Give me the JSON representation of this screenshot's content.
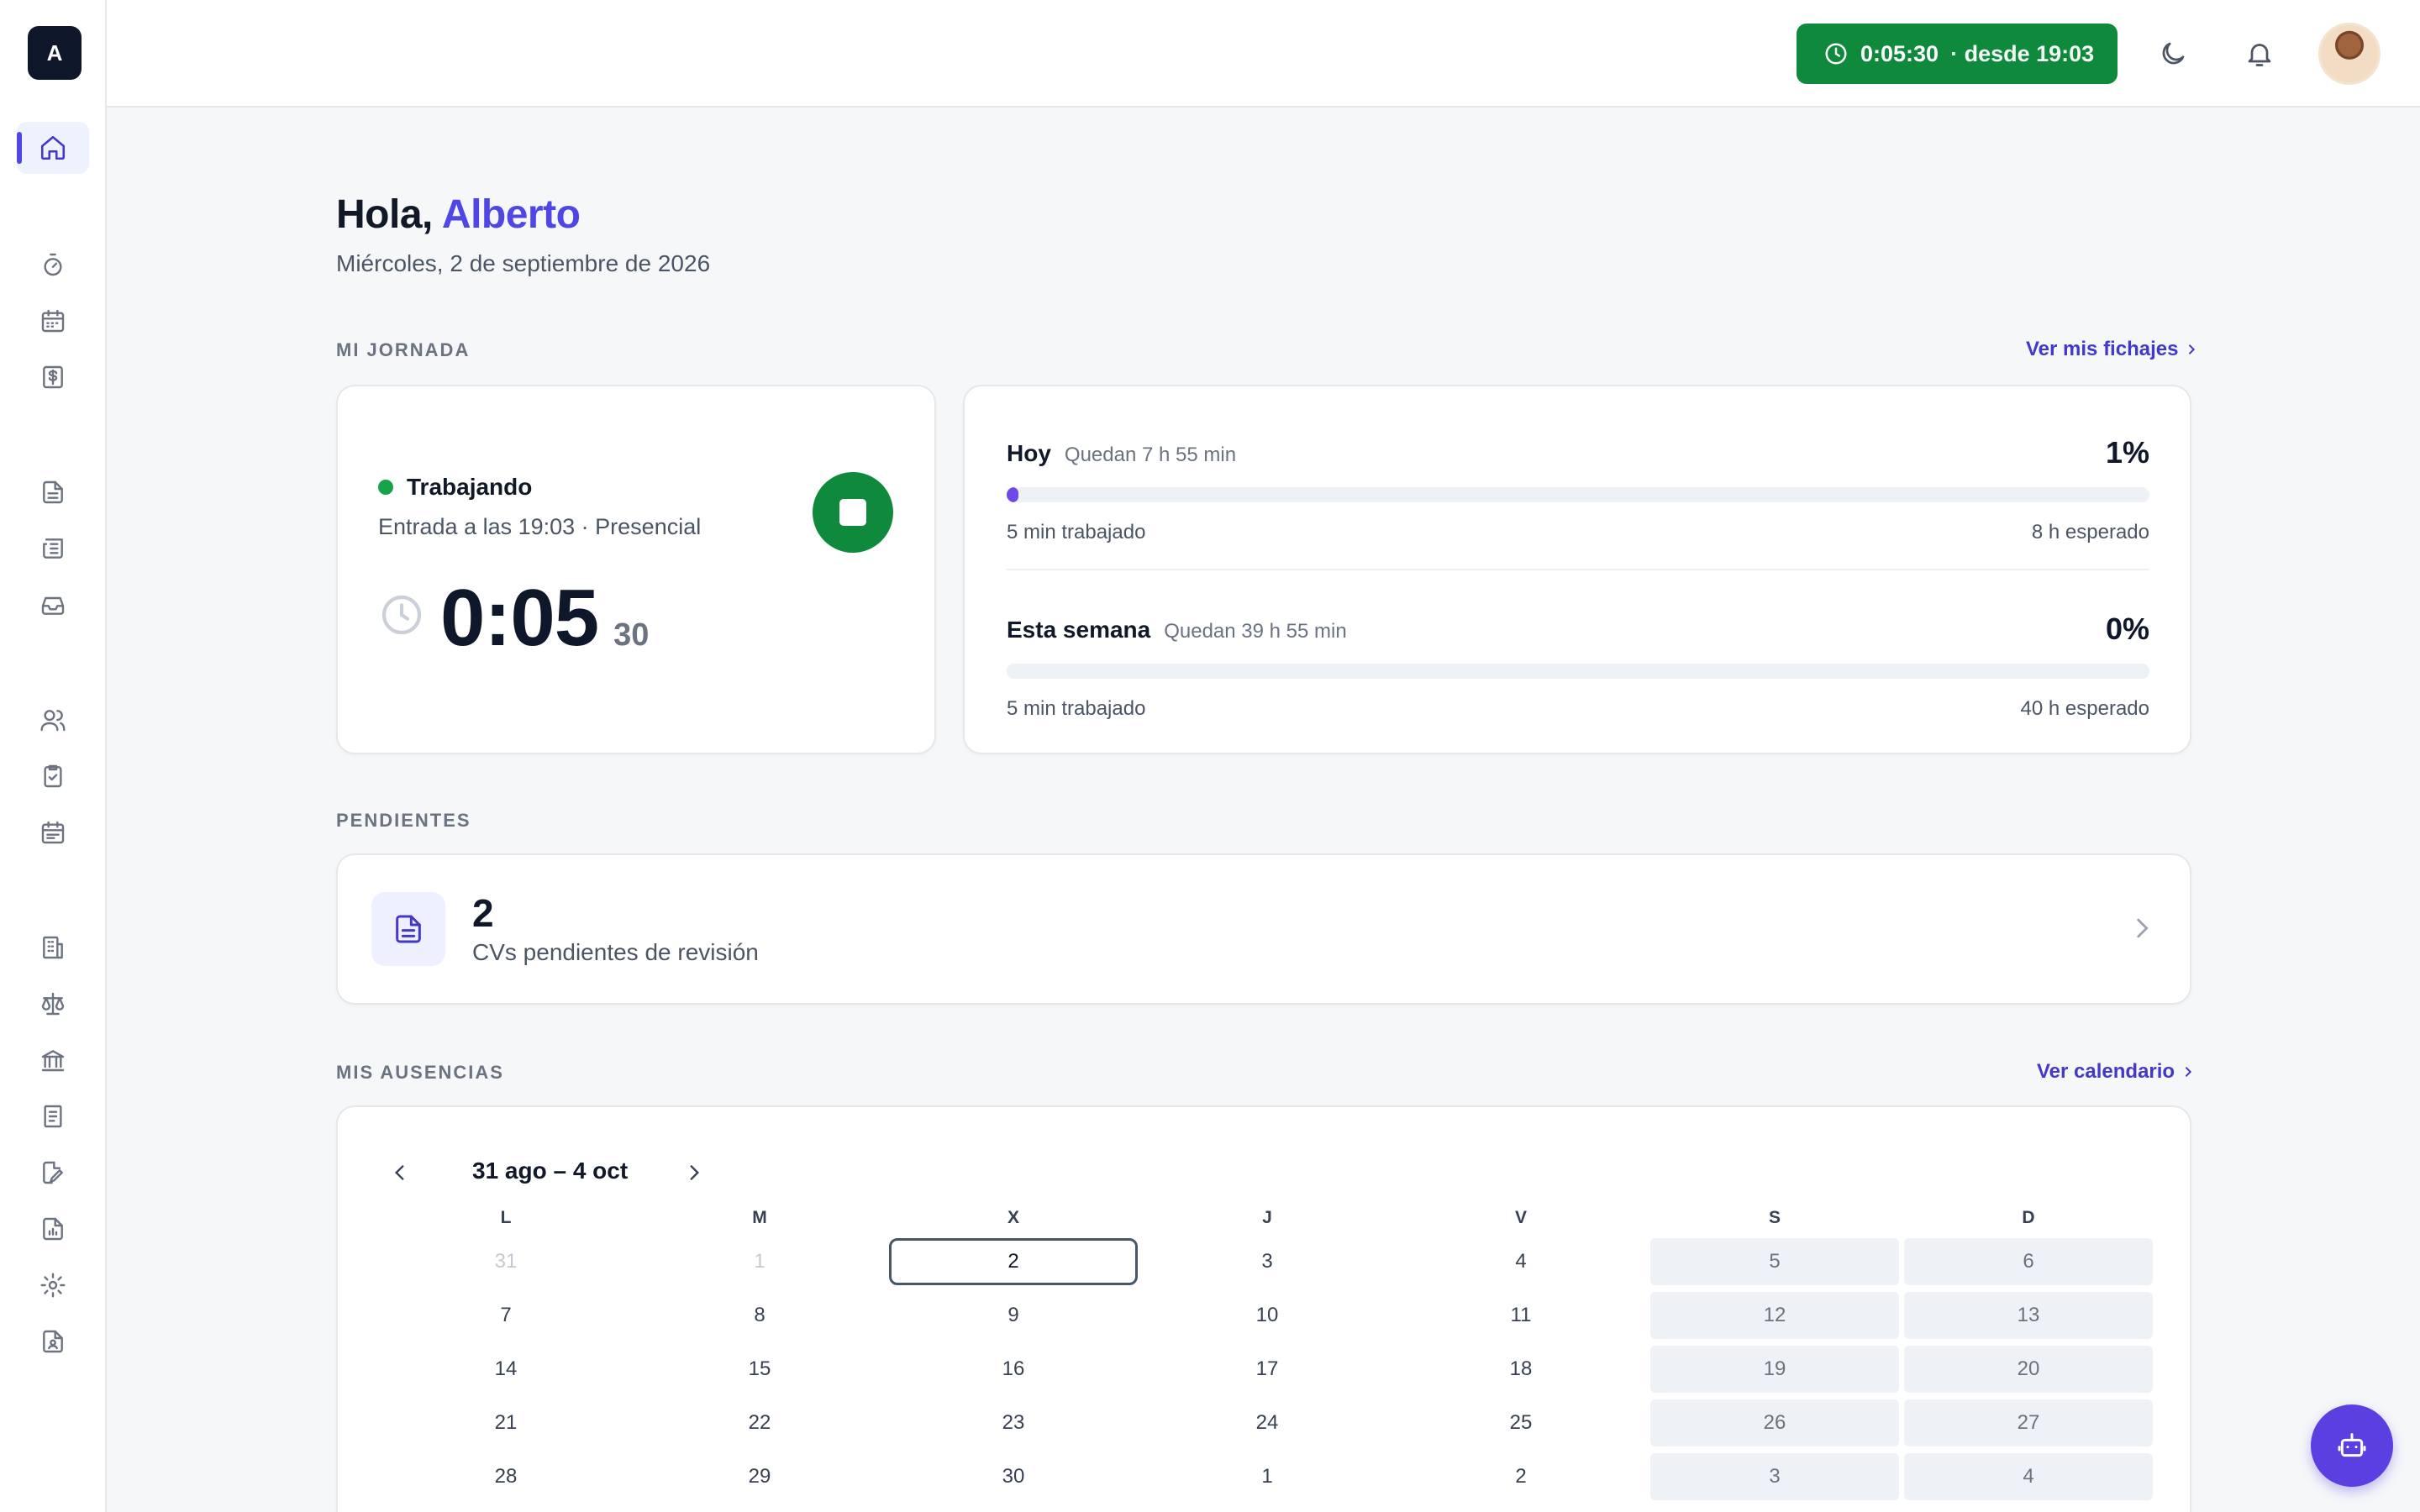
{
  "app": {
    "logo_letter": "A"
  },
  "header": {
    "timer": "0:05:30",
    "since": "· desde 19:03",
    "icons": [
      "clock-icon",
      "moon-icon",
      "bell-icon",
      "avatar"
    ]
  },
  "sidebar": {
    "items": [
      {
        "name": "home",
        "icon": "home-icon",
        "active": true
      },
      {
        "name": "timer",
        "icon": "stopwatch-icon"
      },
      {
        "name": "calendar",
        "icon": "calendar-icon"
      },
      {
        "name": "expenses",
        "icon": "dollar-icon"
      },
      {
        "name": "documents",
        "icon": "document-icon"
      },
      {
        "name": "reports",
        "icon": "newspaper-icon"
      },
      {
        "name": "inbox",
        "icon": "inbox-icon"
      },
      {
        "name": "people",
        "icon": "users-icon"
      },
      {
        "name": "tasks",
        "icon": "clipboard-check-icon"
      },
      {
        "name": "schedule",
        "icon": "calendar-list-icon"
      },
      {
        "name": "company",
        "icon": "building-icon"
      },
      {
        "name": "legal",
        "icon": "scale-icon"
      },
      {
        "name": "bank",
        "icon": "bank-icon"
      },
      {
        "name": "invoices",
        "icon": "receipt-icon"
      },
      {
        "name": "signatures",
        "icon": "file-edit-icon"
      },
      {
        "name": "analytics",
        "icon": "chart-file-icon"
      },
      {
        "name": "settings",
        "icon": "gear-icon"
      },
      {
        "name": "contracts",
        "icon": "file-user-icon"
      }
    ]
  },
  "greeting": {
    "hello": "Hola, ",
    "name": "Alberto",
    "date": "Miércoles, 2 de septiembre de 2026"
  },
  "jornada": {
    "label": "MI JORNADA",
    "link": "Ver mis fichajes",
    "status": "Trabajando",
    "entry": "Entrada a las 19:03 · Presencial",
    "time_main": "0:05",
    "time_secs": "30",
    "today": {
      "title": "Hoy",
      "remaining": "Quedan 7 h 55 min",
      "percent": "1%",
      "progress": 0.01,
      "worked": "5 min trabajado",
      "expected": "8 h esperado"
    },
    "week": {
      "title": "Esta semana",
      "remaining": "Quedan 39 h 55 min",
      "percent": "0%",
      "progress": 0,
      "worked": "5 min trabajado",
      "expected": "40 h esperado"
    }
  },
  "pendientes": {
    "label": "PENDIENTES",
    "count": "2",
    "text": "CVs pendientes de revisión"
  },
  "ausencias": {
    "label": "MIS AUSENCIAS",
    "link": "Ver calendario",
    "range": "31 ago – 4 oct",
    "weekdays": [
      "L",
      "M",
      "X",
      "J",
      "V",
      "S",
      "D"
    ],
    "weeks": [
      [
        "31",
        "1",
        "2",
        "3",
        "4",
        "5",
        "6"
      ],
      [
        "7",
        "8",
        "9",
        "10",
        "11",
        "12",
        "13"
      ],
      [
        "14",
        "15",
        "16",
        "17",
        "18",
        "19",
        "20"
      ],
      [
        "21",
        "22",
        "23",
        "24",
        "25",
        "26",
        "27"
      ],
      [
        "28",
        "29",
        "30",
        "1",
        "2",
        "3",
        "4"
      ]
    ],
    "today": "2"
  },
  "colors": {
    "accent": "#4f46e5",
    "success": "#0f8a3c"
  }
}
